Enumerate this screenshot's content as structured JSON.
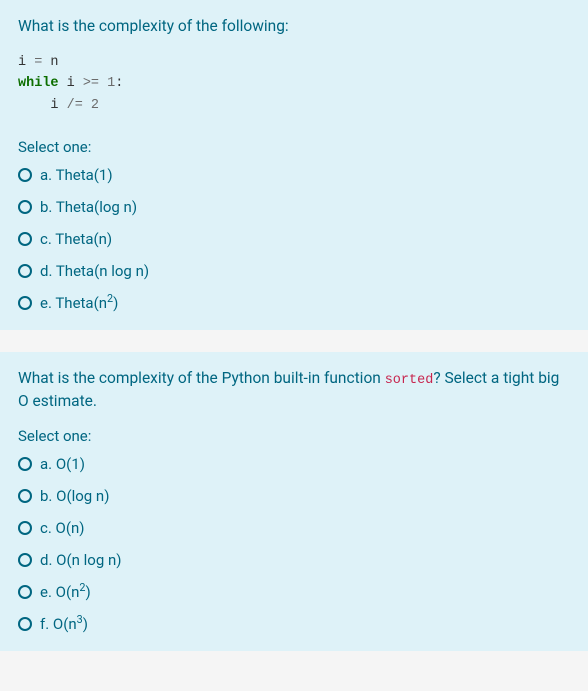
{
  "q1": {
    "prompt": "What is the complexity of the following:",
    "code": {
      "line1_a": "i ",
      "line1_b": "=",
      "line1_c": " n",
      "line2_a": "while",
      "line2_b": " i ",
      "line2_c": ">=",
      "line2_d": " ",
      "line2_e": "1",
      "line2_f": ":",
      "line3_a": "    i ",
      "line3_b": "/=",
      "line3_c": " ",
      "line3_d": "2"
    },
    "select_label": "Select one:",
    "options": [
      {
        "letter": "a.",
        "text": "Theta(1)"
      },
      {
        "letter": "b.",
        "text": "Theta(log n)"
      },
      {
        "letter": "c.",
        "text": "Theta(n)"
      },
      {
        "letter": "d.",
        "text": "Theta(n log n)"
      },
      {
        "letter": "e.",
        "text_pre": "Theta(n",
        "sup": "2",
        "text_post": ")"
      }
    ]
  },
  "q2": {
    "prompt_pre": "What is the complexity of the Python built-in function ",
    "prompt_code": "sorted",
    "prompt_post": "? Select a tight big O estimate.",
    "select_label": "Select one:",
    "options": [
      {
        "letter": "a.",
        "text": "O(1)"
      },
      {
        "letter": "b.",
        "text": "O(log n)"
      },
      {
        "letter": "c.",
        "text": "O(n)"
      },
      {
        "letter": "d.",
        "text": "O(n log n)"
      },
      {
        "letter": "e.",
        "text_pre": "O(n",
        "sup": "2",
        "text_post": ")"
      },
      {
        "letter": "f.",
        "text_pre": "O(n",
        "sup": "3",
        "text_post": ")"
      }
    ]
  }
}
